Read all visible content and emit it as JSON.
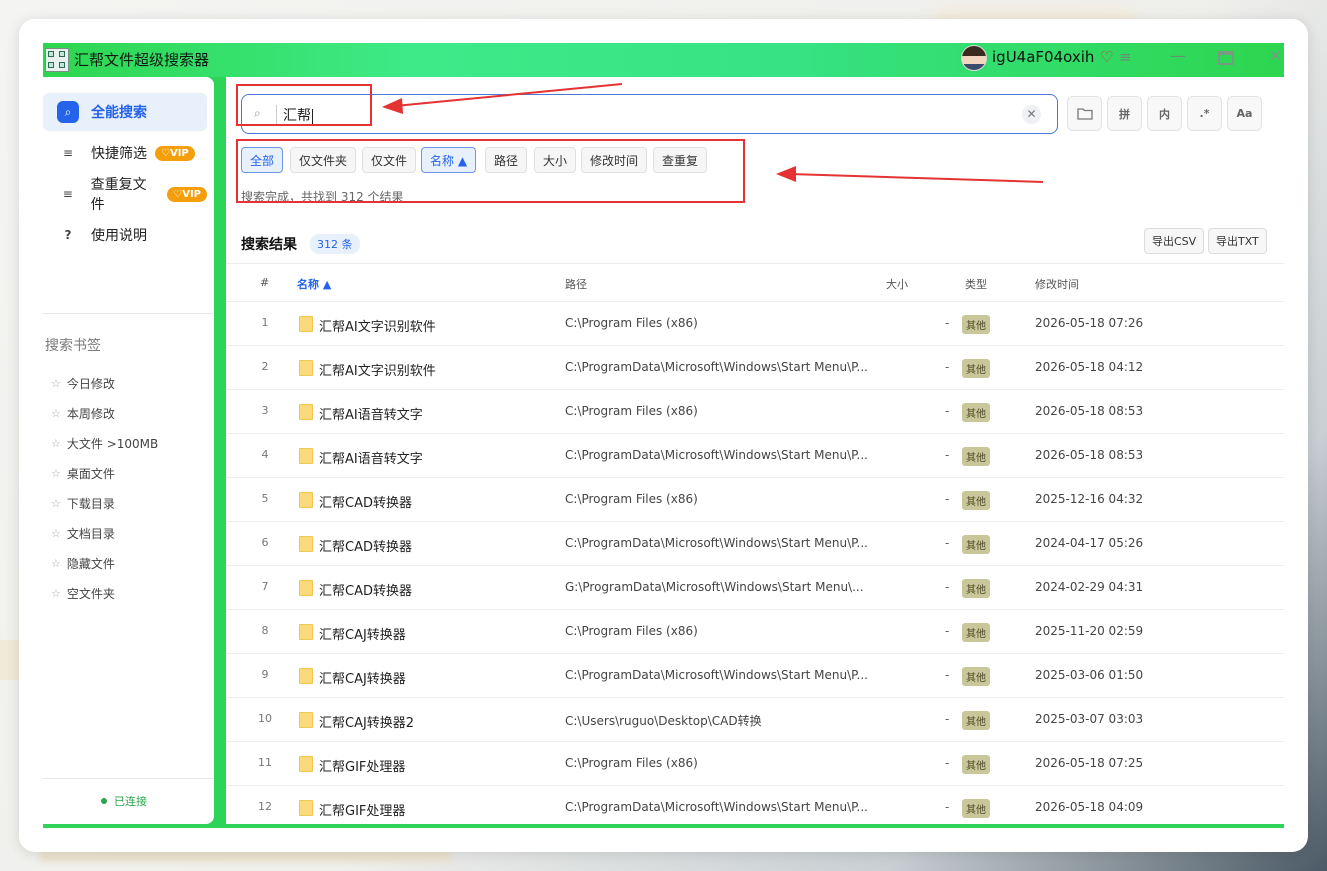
{
  "window": {
    "title": "汇帮文件超级搜索器",
    "username": "igU4aF04oxih",
    "heart_icon": "heart-icon",
    "menu_icon": "menu-icon",
    "minimize": "—",
    "close": "✕",
    "heart_glyph": "♡",
    "menu_glyph": "≡"
  },
  "sidebar": {
    "items": [
      {
        "label": "全能搜索",
        "icon": "⌕",
        "active": true
      },
      {
        "label": "快捷筛选",
        "icon": "≡",
        "vip": "♡VIP"
      },
      {
        "label": "查重复文件",
        "icon": "≡",
        "vip": "♡VIP"
      },
      {
        "label": "使用说明",
        "icon": "?"
      }
    ],
    "bookmarks_title": "搜索书签",
    "bookmarks": [
      "今日修改",
      "本周修改",
      "大文件 >100MB",
      "桌面文件",
      "下载目录",
      "文档目录",
      "隐藏文件",
      "空文件夹"
    ],
    "status": "已连接"
  },
  "search": {
    "value": "汇帮",
    "icon": "⌕",
    "clear": "✕",
    "tools": [
      "folder-icon",
      "拼",
      "内",
      ".*",
      "Aa"
    ]
  },
  "filters": [
    "全部",
    "仅文件夹",
    "仅文件",
    "名称 ▲",
    "路径",
    "大小",
    "修改时间",
    "查重复"
  ],
  "status_text": "搜索完成，共找到 312 个结果",
  "results": {
    "title": "搜索结果",
    "count": "312 条",
    "export_csv": "导出CSV",
    "export_txt": "导出TXT",
    "columns": [
      "#",
      "名称 ▲",
      "路径",
      "大小",
      "类型",
      "修改时间"
    ],
    "rows": [
      {
        "n": "1",
        "name": "汇帮AI文字识别软件",
        "path": "C:\\Program Files (x86)",
        "size": "-",
        "type": "其他",
        "mtime": "2026-05-18 07:26"
      },
      {
        "n": "2",
        "name": "汇帮AI文字识别软件",
        "path": "C:\\ProgramData\\Microsoft\\Windows\\Start Menu\\P...",
        "size": "-",
        "type": "其他",
        "mtime": "2026-05-18 04:12"
      },
      {
        "n": "3",
        "name": "汇帮AI语音转文字",
        "path": "C:\\Program Files (x86)",
        "size": "-",
        "type": "其他",
        "mtime": "2026-05-18 08:53"
      },
      {
        "n": "4",
        "name": "汇帮AI语音转文字",
        "path": "C:\\ProgramData\\Microsoft\\Windows\\Start Menu\\P...",
        "size": "-",
        "type": "其他",
        "mtime": "2026-05-18 08:53"
      },
      {
        "n": "5",
        "name": "汇帮CAD转换器",
        "path": "C:\\Program Files (x86)",
        "size": "-",
        "type": "其他",
        "mtime": "2025-12-16 04:32"
      },
      {
        "n": "6",
        "name": "汇帮CAD转换器",
        "path": "C:\\ProgramData\\Microsoft\\Windows\\Start Menu\\P...",
        "size": "-",
        "type": "其他",
        "mtime": "2024-04-17 05:26"
      },
      {
        "n": "7",
        "name": "汇帮CAD转换器",
        "path": "G:\\ProgramData\\Microsoft\\Windows\\Start Menu\\...",
        "size": "-",
        "type": "其他",
        "mtime": "2024-02-29 04:31"
      },
      {
        "n": "8",
        "name": "汇帮CAJ转换器",
        "path": "C:\\Program Files (x86)",
        "size": "-",
        "type": "其他",
        "mtime": "2025-11-20 02:59"
      },
      {
        "n": "9",
        "name": "汇帮CAJ转换器",
        "path": "C:\\ProgramData\\Microsoft\\Windows\\Start Menu\\P...",
        "size": "-",
        "type": "其他",
        "mtime": "2025-03-06 01:50"
      },
      {
        "n": "10",
        "name": "汇帮CAJ转换器2",
        "path": "C:\\Users\\ruguo\\Desktop\\CAD转换",
        "size": "-",
        "type": "其他",
        "mtime": "2025-03-07 03:03"
      },
      {
        "n": "11",
        "name": "汇帮GIF处理器",
        "path": "C:\\Program Files (x86)",
        "size": "-",
        "type": "其他",
        "mtime": "2026-05-18 07:25"
      },
      {
        "n": "12",
        "name": "汇帮GIF处理器",
        "path": "C:\\ProgramData\\Microsoft\\Windows\\Start Menu\\P...",
        "size": "-",
        "type": "其他",
        "mtime": "2026-05-18 04:09"
      }
    ]
  },
  "colors": {
    "accent": "#2563eb",
    "title_bar": "#2ed45a",
    "annotation": "#e53232",
    "vip": "#f59e0b"
  }
}
